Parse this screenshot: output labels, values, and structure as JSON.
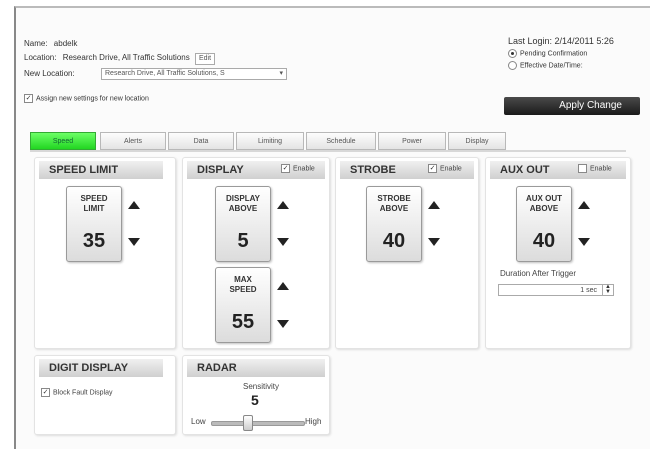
{
  "header": {
    "name_label": "Name:",
    "name_value": "abdelk",
    "location_label": "Location:",
    "location_value": "Research Drive, All Traffic Solutions",
    "location_btn": "Edit",
    "new_location_label": "New Location:",
    "new_location_value": "Research Drive, All Traffic Solutions, S",
    "keep_settings_label": "Assign new settings for new location",
    "last_login": "Last Login: 2/14/2011 5:26",
    "pending_label": "Pending Confirmation",
    "effective_label": "Effective Date/Time:",
    "apply_label": "Apply Change"
  },
  "tabs": [
    {
      "label": "Speed"
    },
    {
      "label": "Alerts"
    },
    {
      "label": "Data"
    },
    {
      "label": "Limiting"
    },
    {
      "label": "Schedule"
    },
    {
      "label": "Power"
    },
    {
      "label": "Display"
    }
  ],
  "panels": {
    "speed_limit": {
      "title": "SPEED LIMIT",
      "box_label_1": "SPEED",
      "box_label_2": "LIMIT",
      "value": "35"
    },
    "display": {
      "title": "DISPLAY",
      "enable_label": "Enable",
      "above_label_1": "DISPLAY",
      "above_label_2": "ABOVE",
      "above_value": "5",
      "max_label_1": "MAX",
      "max_label_2": "SPEED",
      "max_value": "55"
    },
    "strobe": {
      "title": "STROBE",
      "enable_label": "Enable",
      "label_1": "STROBE",
      "label_2": "ABOVE",
      "value": "40"
    },
    "aux_out": {
      "title": "AUX OUT",
      "enable_label": "Enable",
      "label_1": "AUX OUT",
      "label_2": "ABOVE",
      "value": "40",
      "duration_label": "Duration After Trigger",
      "duration_value": "1 sec"
    },
    "digit_display": {
      "title": "DIGIT DISPLAY",
      "option_label": "Block Fault Display"
    },
    "radar": {
      "title": "RADAR",
      "sensitivity_label": "Sensitivity",
      "sensitivity_value": "5",
      "low_label": "Low",
      "high_label": "High"
    }
  }
}
